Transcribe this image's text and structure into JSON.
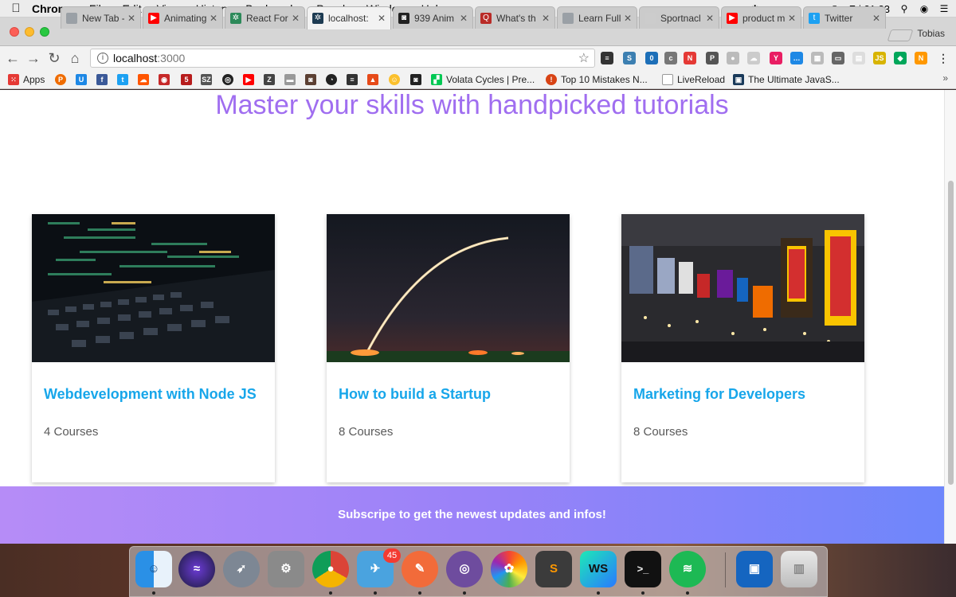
{
  "menubar": {
    "app": "Chrome",
    "items": [
      "File",
      "Edit",
      "View",
      "History",
      "Bookmarks",
      "People",
      "Window",
      "Help"
    ],
    "clock": "Fri 21:33"
  },
  "tabs": [
    {
      "label": "New Tab - To",
      "icon": "document-icon",
      "color": "#9aa0a6"
    },
    {
      "label": "Animating",
      "icon": "youtube-icon",
      "color": "#ff0000"
    },
    {
      "label": "React For",
      "icon": "react-icon",
      "color": "#2d8a5a"
    },
    {
      "label": "localhost:",
      "icon": "react-icon",
      "color": "#1d3b52"
    },
    {
      "label": "939 Anim",
      "icon": "camera-icon",
      "color": "#222222"
    },
    {
      "label": "What's th",
      "icon": "quora-icon",
      "color": "#b92b27"
    },
    {
      "label": "Learn Full",
      "icon": "document-icon",
      "color": "#9aa0a6"
    },
    {
      "label": "Sportnacl",
      "icon": "site-icon",
      "color": "#cccccc"
    },
    {
      "label": "product m",
      "icon": "youtube-icon",
      "color": "#ff0000"
    },
    {
      "label": "Twitter",
      "icon": "twitter-icon",
      "color": "#1da1f2"
    }
  ],
  "profile": "Tobias",
  "address": {
    "host": "localhost",
    "port": ":3000"
  },
  "bookmarks": {
    "apps": "Apps",
    "labeled": [
      "Volata Cycles | Pre...",
      "Top 10 Mistakes N...",
      "LiveReload",
      "The Ultimate JavaS..."
    ]
  },
  "page": {
    "headline": "Master your skills with handpicked tutorials",
    "cards": [
      {
        "title": "Webdevelopment with Node JS",
        "count": "4 Courses",
        "image": "laptop-code-photo"
      },
      {
        "title": "How to build a Startup",
        "count": "8 Courses",
        "image": "rocket-launch-photo"
      },
      {
        "title": "Marketing for Developers",
        "count": "8 Courses",
        "image": "city-billboards-photo"
      }
    ],
    "subscribe": "Subscripe to get the newest updates and infos!"
  },
  "dock": {
    "badge": "45",
    "apps": [
      "Finder",
      "Siri",
      "Launchpad",
      "System Preferences",
      "Chrome",
      "Tweetbot",
      "Postman",
      "GitHub Desktop",
      "Photos",
      "Sublime Text",
      "WebStorm",
      "Terminal",
      "Spotify",
      "Desktop Folder",
      "Trash"
    ]
  },
  "colors": {
    "headline": "#a06ef0",
    "card_title": "#17a6ea",
    "subscribe_gradient_start": "#b68cf7",
    "subscribe_gradient_end": "#6e86fb"
  }
}
